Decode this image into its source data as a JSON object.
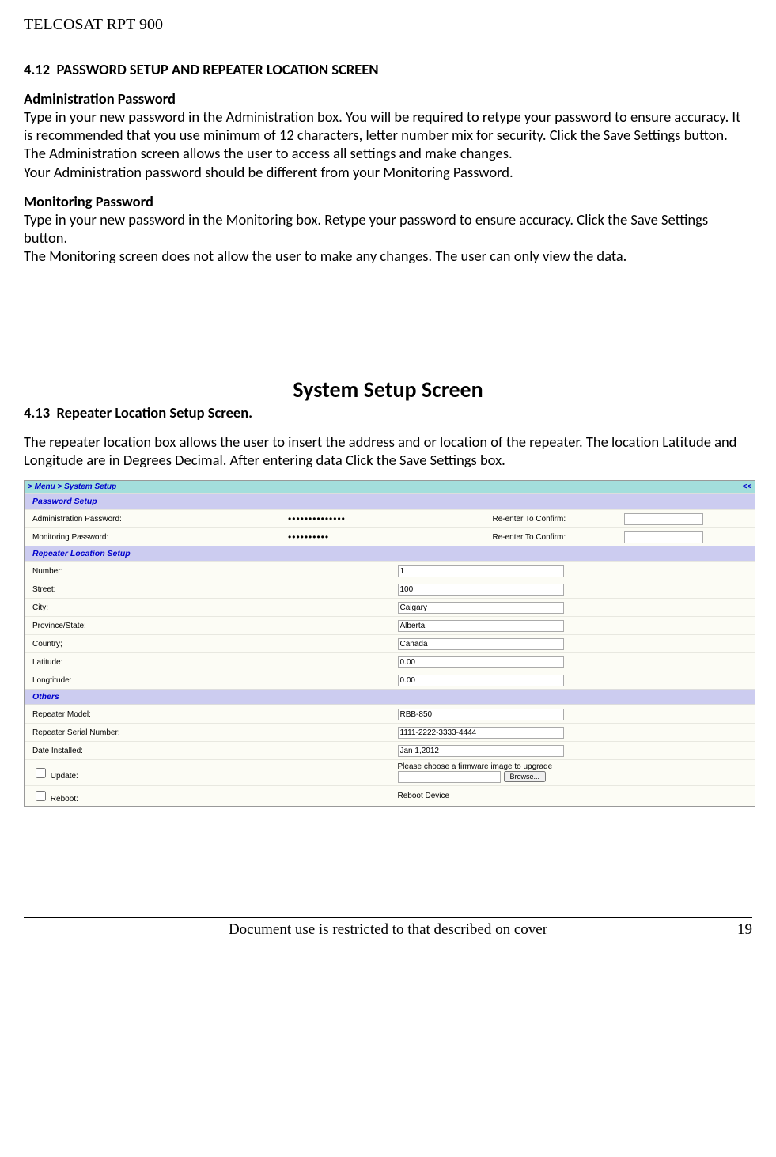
{
  "header": {
    "title": "TELCOSAT RPT 900"
  },
  "section_412": {
    "number": "4.12",
    "title": "PASSWORD SETUP AND REPEATER LOCATION SCREEN",
    "admin_heading": "Administration Password",
    "admin_p1": "Type in your new password in the Administration box. You will be required to retype your password to ensure accuracy.  It is recommended that you use minimum of 12 characters, letter number mix for security. Click the Save Settings button.",
    "admin_p2": "The Administration screen allows the user to access all settings and make changes.",
    "admin_p3": "Your Administration password should be different from your Monitoring Password.",
    "mon_heading": "Monitoring Password",
    "mon_p1": "Type in your new password in the Monitoring box. Retype your password to ensure accuracy. Click  the Save Settings button.",
    "mon_p2": "The Monitoring screen does not allow the user to make any changes. The user can only view the data."
  },
  "mid_title": "System Setup Screen",
  "section_413": {
    "number": "4.13",
    "title": "Repeater Location Setup Screen.",
    "p1": "The repeater location box allows the user to insert the address and or location of the repeater. The location Latitude and Longitude are in Degrees Decimal. After entering data Click the Save Settings box."
  },
  "screenshot": {
    "breadcrumb_left": "> Menu > System Setup",
    "breadcrumb_right": "<<",
    "sec_password": "Password Setup",
    "admin_pw_label": "Administration Password:",
    "admin_pw_value": "••••••••••••••",
    "mon_pw_label": "Monitoring Password:",
    "mon_pw_value": "••••••••••",
    "reenter_label": "Re-enter To Confirm:",
    "sec_location": "Repeater Location Setup",
    "number_label": "Number:",
    "number_value": "1",
    "street_label": "Street:",
    "street_value": "100",
    "city_label": "City:",
    "city_value": "Calgary",
    "province_label": "Province/State:",
    "province_value": "Alberta",
    "country_label": "Country;",
    "country_value": "Canada",
    "lat_label": "Latitude:",
    "lat_value": "0.00",
    "lon_label": "Longtitude:",
    "lon_value": "0.00",
    "sec_others": "Others",
    "model_label": "Repeater Model:",
    "model_value": "RBB-850",
    "serial_label": "Repeater Serial Number:",
    "serial_value": "1111-2222-3333-4444",
    "date_label": "Date Installed:",
    "date_value": "Jan 1,2012",
    "update_label": "Update:",
    "update_text": "Please choose a firmware image to upgrade",
    "browse_label": "Browse...",
    "reboot_label": "Reboot:",
    "reboot_text": "Reboot Device"
  },
  "footer": {
    "text": "Document use is restricted to that described on cover",
    "page": "19"
  }
}
